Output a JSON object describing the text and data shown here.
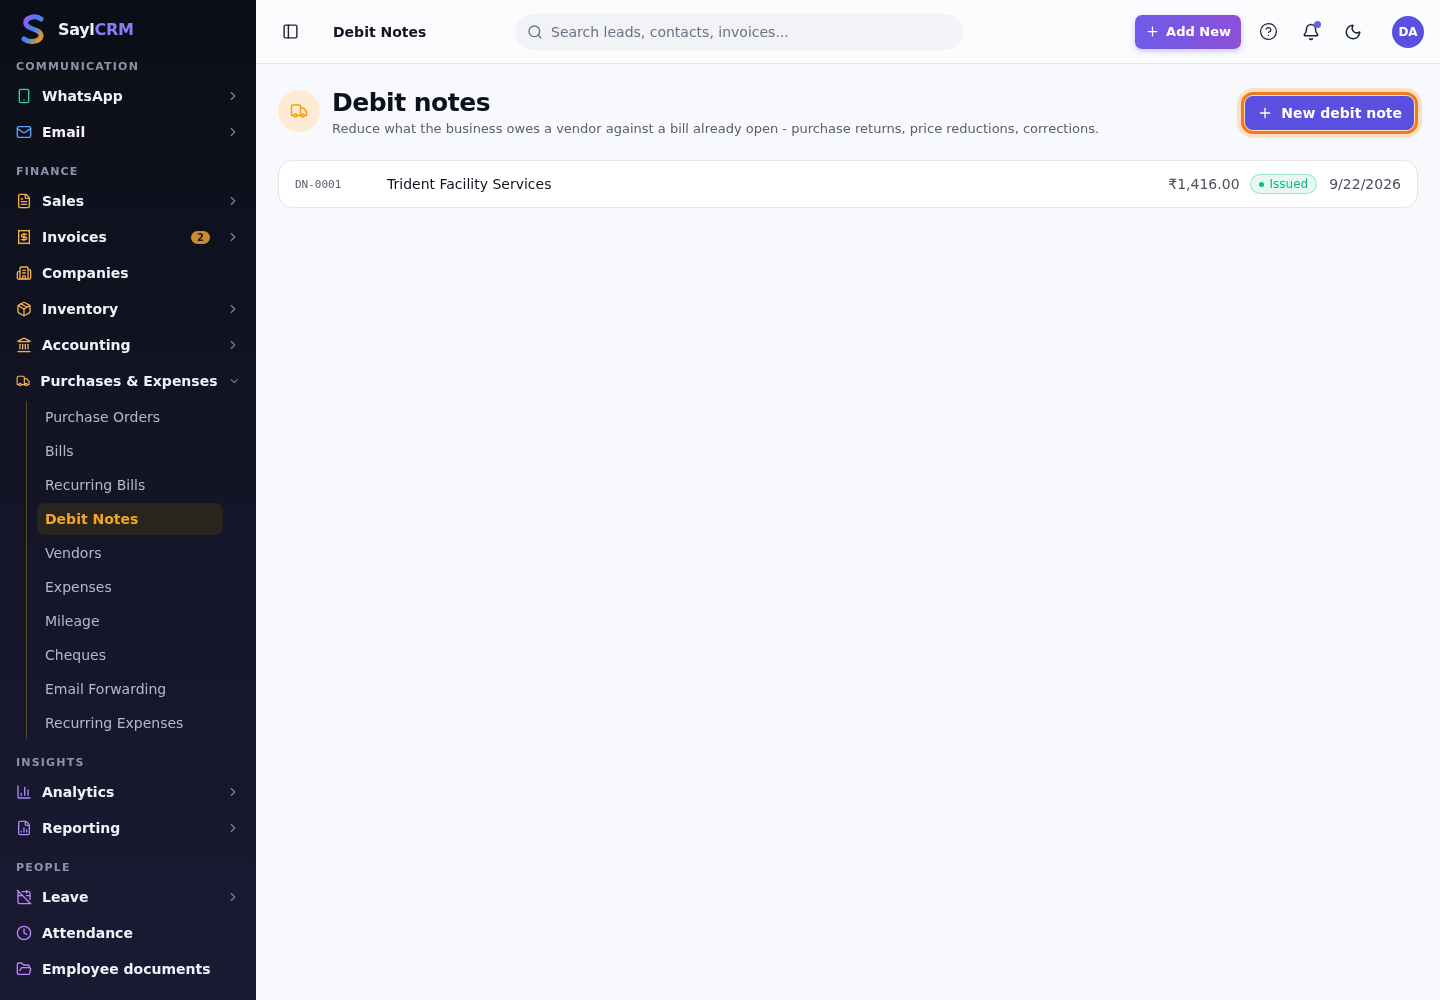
{
  "brand": {
    "name": "Sayl",
    "accent": "CRM"
  },
  "sidebar": {
    "sections": [
      {
        "title": "COMMUNICATION",
        "items": [
          {
            "label": "WhatsApp",
            "expanded": false
          },
          {
            "label": "Email",
            "expanded": false
          }
        ]
      },
      {
        "title": "FINANCE",
        "items": [
          {
            "label": "Sales",
            "expanded": false
          },
          {
            "label": "Invoices",
            "badge": "2",
            "expanded": false
          },
          {
            "label": "Companies"
          },
          {
            "label": "Inventory",
            "expanded": false
          },
          {
            "label": "Accounting",
            "expanded": false
          },
          {
            "label": "Purchases & Expenses",
            "expanded": true,
            "children": [
              {
                "label": "Purchase Orders",
                "selected": false
              },
              {
                "label": "Bills",
                "selected": false
              },
              {
                "label": "Recurring Bills",
                "selected": false
              },
              {
                "label": "Debit Notes",
                "selected": true
              },
              {
                "label": "Vendors",
                "selected": false
              },
              {
                "label": "Expenses",
                "selected": false
              },
              {
                "label": "Mileage",
                "selected": false
              },
              {
                "label": "Cheques",
                "selected": false
              },
              {
                "label": "Email Forwarding",
                "selected": false
              },
              {
                "label": "Recurring Expenses",
                "selected": false
              }
            ]
          }
        ]
      },
      {
        "title": "INSIGHTS",
        "items": [
          {
            "label": "Analytics",
            "expanded": false
          },
          {
            "label": "Reporting",
            "expanded": false
          }
        ]
      },
      {
        "title": "PEOPLE",
        "items": [
          {
            "label": "Leave",
            "expanded": false
          },
          {
            "label": "Attendance"
          },
          {
            "label": "Employee documents"
          }
        ]
      }
    ]
  },
  "topbar": {
    "breadcrumb": "Debit Notes",
    "search": {
      "placeholder": "Search leads, contacts, invoices..."
    },
    "add_button": "Add New",
    "notifications_unread": true,
    "avatar": "DA"
  },
  "page": {
    "title": "Debit notes",
    "subtitle": "Reduce what the business owes a vendor against a bill already open - purchase returns, price reductions, corrections.",
    "new_button": {
      "label": "New debit note",
      "focused": true
    }
  },
  "rows": [
    {
      "number": "DN-0001",
      "vendor": "Trident Facility Services",
      "amount": "₹1,416.00",
      "status": {
        "label": "Issued",
        "color": "#10b981"
      },
      "date": "9/22/2026"
    }
  ]
}
